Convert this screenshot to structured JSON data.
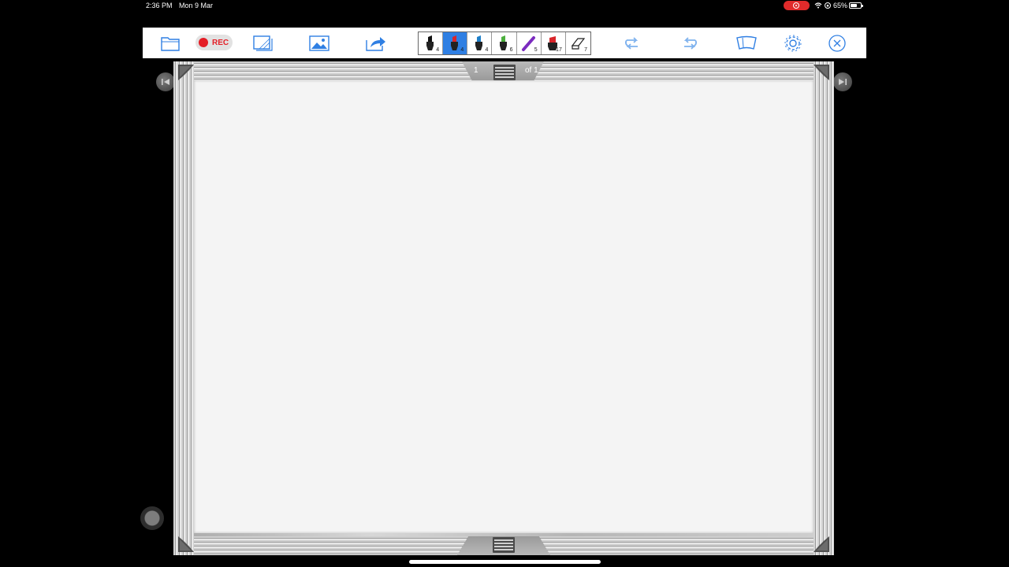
{
  "status_bar": {
    "time": "2:36 PM",
    "date": "Mon 9 Mar",
    "battery": "65%",
    "battery_level": 0.65,
    "recording_color": "#e02b2b"
  },
  "toolbar": {
    "rec_label": "REC",
    "accent_color": "#2f7fe3",
    "pens": [
      {
        "name": "black-marker",
        "color": "#111111",
        "size": "4"
      },
      {
        "name": "red-marker",
        "color": "#d9262b",
        "size": "4",
        "active": true
      },
      {
        "name": "blue-marker",
        "color": "#1e7fc9",
        "size": "4"
      },
      {
        "name": "green-marker",
        "color": "#4caf3d",
        "size": "6"
      },
      {
        "name": "purple-pen",
        "color": "#7b2bbf",
        "size": "5"
      },
      {
        "name": "red-highlighter",
        "color": "#d9262b",
        "size": "17"
      },
      {
        "name": "eraser",
        "color": "#ffffff",
        "size": "7"
      }
    ]
  },
  "whiteboard": {
    "page_current": "1",
    "page_total": "of 1"
  }
}
